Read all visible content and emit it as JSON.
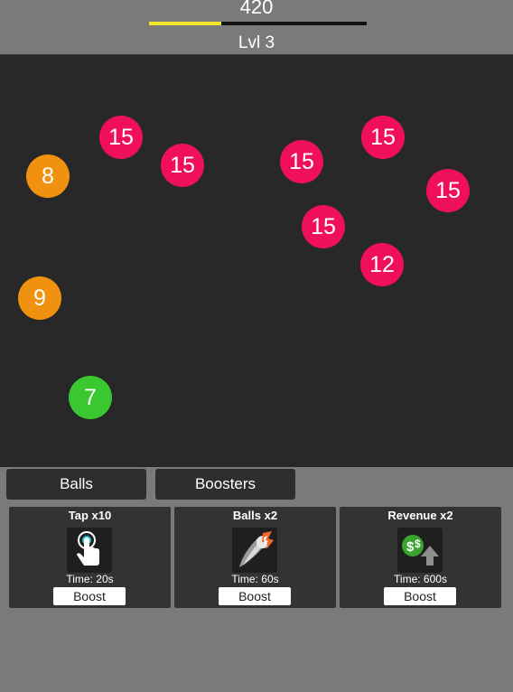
{
  "header": {
    "score": "420",
    "level_label": "Lvl 3",
    "progress_fraction": 0.33,
    "progress_color": "#f4e52a"
  },
  "field": {
    "balls": [
      {
        "value": "15",
        "color": "#f0105a"
      },
      {
        "value": "15",
        "color": "#f0105a"
      },
      {
        "value": "15",
        "color": "#f0105a"
      },
      {
        "value": "15",
        "color": "#f0105a"
      },
      {
        "value": "8",
        "color": "#f0920f"
      },
      {
        "value": "15",
        "color": "#f0105a"
      },
      {
        "value": "15",
        "color": "#f0105a"
      },
      {
        "value": "12",
        "color": "#f0105a"
      },
      {
        "value": "9",
        "color": "#f0920f"
      },
      {
        "value": "7",
        "color": "#3ac72f"
      }
    ]
  },
  "tabs": [
    {
      "label": "Balls"
    },
    {
      "label": "Boosters"
    }
  ],
  "boosters": [
    {
      "title": "Tap x10",
      "time": "Time: 20s",
      "button": "Boost",
      "icon": "tap-hand-icon"
    },
    {
      "title": "Balls x2",
      "time": "Time: 60s",
      "button": "Boost",
      "icon": "speeding-ball-icon"
    },
    {
      "title": "Revenue x2",
      "time": "Time: 600s",
      "button": "Boost",
      "icon": "revenue-up-icon"
    }
  ]
}
